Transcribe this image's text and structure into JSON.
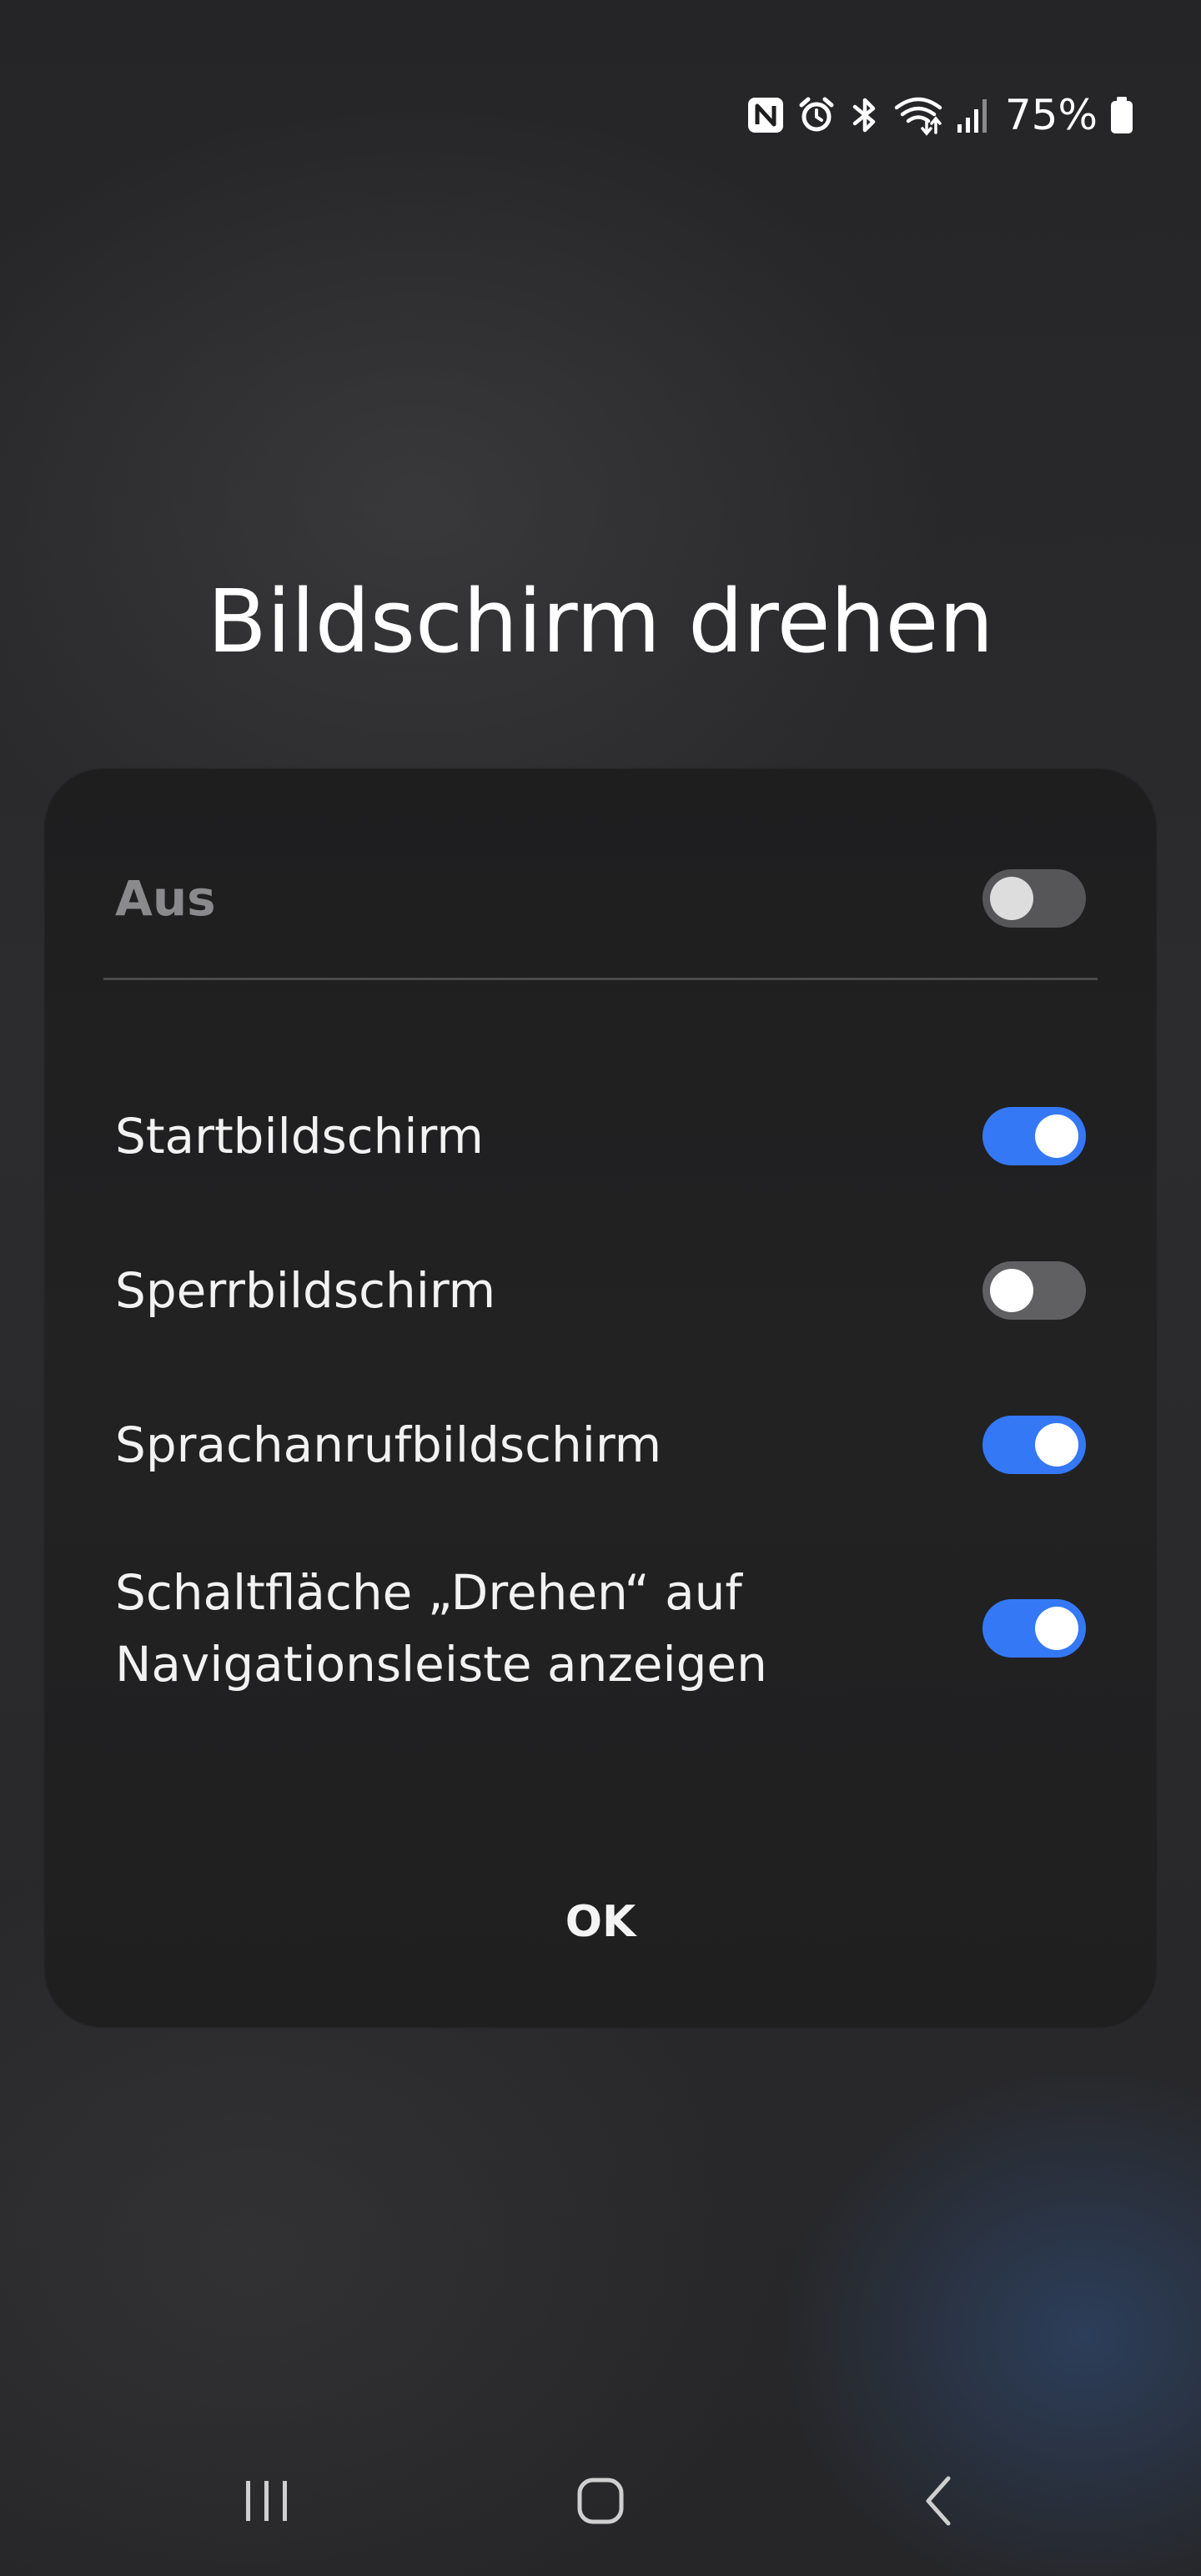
{
  "status_bar": {
    "icons": [
      "nfc-icon",
      "alarm-icon",
      "bluetooth-icon",
      "wifi-icon",
      "signal-icon",
      "battery-icon"
    ],
    "battery_percent": "75%"
  },
  "title": "Bildschirm drehen",
  "dialog": {
    "rows": [
      {
        "label": "Aus",
        "state": "off",
        "enabled": false
      },
      {
        "label": "Startbildschirm",
        "state": "on",
        "enabled": true
      },
      {
        "label": "Sperrbildschirm",
        "state": "off",
        "enabled": true
      },
      {
        "label": "Sprachanrufbildschirm",
        "state": "on",
        "enabled": true
      },
      {
        "label_line1": "Schaltfläche „Drehen“ auf",
        "label_line2": "Navigationsleiste anzeigen",
        "state": "on",
        "enabled": true
      }
    ],
    "ok_label": "OK"
  },
  "nav_bar": {
    "icons": [
      "recent-apps-icon",
      "home-icon",
      "back-icon"
    ]
  },
  "colors": {
    "toggle_on": "#3478f6",
    "toggle_off": "#606063",
    "dialog_bg": "#202021"
  }
}
